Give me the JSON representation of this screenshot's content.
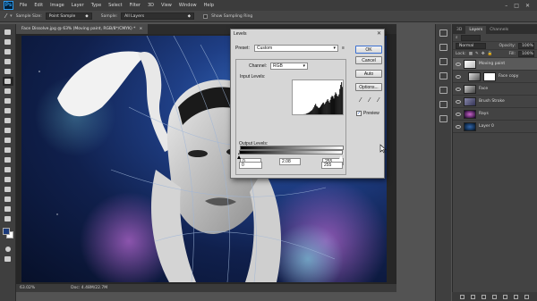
{
  "app": {
    "logo": "Ps"
  },
  "menu": [
    "File",
    "Edit",
    "Image",
    "Layer",
    "Type",
    "Select",
    "Filter",
    "3D",
    "View",
    "Window",
    "Help"
  ],
  "window_controls": [
    "–",
    "□",
    "✕"
  ],
  "options": {
    "sample_size_label": "Sample Size:",
    "sample_size_value": "Point Sample",
    "sample_label": "Sample:",
    "sample_value": "All Layers",
    "show_ring_label": "Show Sampling Ring"
  },
  "document": {
    "tab_title": "Face Dissolve.jpg @ 63% (Moving paint, RGB/8*/CMYK) *",
    "zoom": "63.02%",
    "doc_size": "Doc: 4.48M/22.7M"
  },
  "layers_panel": {
    "tabs": [
      "3D",
      "Layers",
      "Channels"
    ],
    "blend_mode": "Normal",
    "opacity_label": "Opacity:",
    "opacity_value": "100%",
    "lock_label": "Lock:",
    "fill_label": "Fill:",
    "fill_value": "100%",
    "layers": [
      {
        "name": "Moving paint",
        "selected": true,
        "indent": false
      },
      {
        "name": "Face copy",
        "selected": false,
        "indent": true
      },
      {
        "name": "Face",
        "selected": false,
        "indent": false
      },
      {
        "name": "Brush Stroke",
        "selected": false,
        "indent": false
      },
      {
        "name": "Rays",
        "selected": false,
        "indent": false
      },
      {
        "name": "Layer 0",
        "selected": false,
        "indent": false
      }
    ]
  },
  "levels_dialog": {
    "title": "Levels",
    "preset_label": "Preset:",
    "preset_value": "Custom",
    "channel_label": "Channel:",
    "channel_value": "RGB",
    "input_levels_label": "Input Levels:",
    "input_black": "0",
    "input_gamma": "2.08",
    "input_white": "255",
    "output_levels_label": "Output Levels:",
    "output_black": "0",
    "output_white": "255",
    "ok_label": "OK",
    "cancel_label": "Cancel",
    "auto_label": "Auto",
    "options_label": "Options...",
    "preview_label": "Preview",
    "preview_checked": true,
    "histogram": [
      2,
      1,
      1,
      2,
      1,
      3,
      2,
      2,
      4,
      3,
      3,
      5,
      4,
      6,
      5,
      7,
      8,
      9,
      10,
      12,
      14,
      16,
      18,
      22,
      26,
      32,
      36,
      30,
      28,
      25,
      24,
      26,
      30,
      34,
      38,
      40,
      35,
      38,
      42,
      46,
      50,
      44,
      40,
      48,
      56,
      60,
      58,
      52,
      62,
      70,
      66,
      60,
      58,
      64,
      80,
      92,
      100,
      86,
      70,
      58
    ]
  }
}
